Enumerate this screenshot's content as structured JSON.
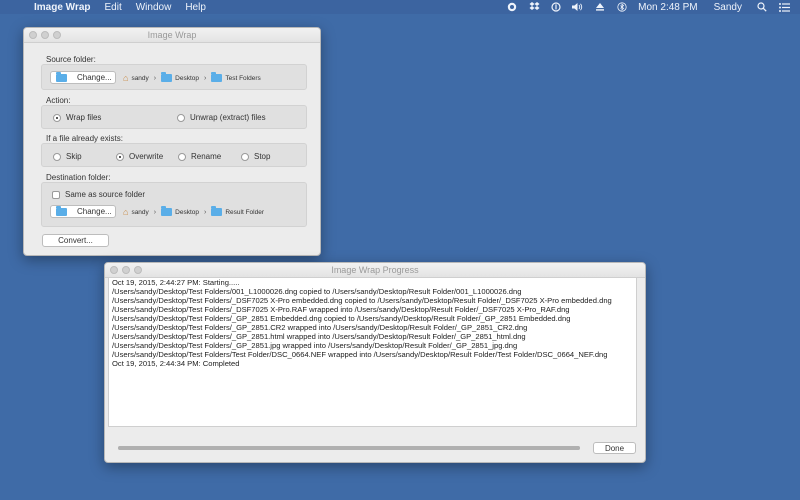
{
  "menubar": {
    "apple_glyph": "",
    "app_name": "Image Wrap",
    "menus": [
      "Edit",
      "Window",
      "Help"
    ],
    "clock": "Mon 2:48 PM",
    "user": "Sandy"
  },
  "main_window": {
    "title": "Image Wrap",
    "source": {
      "label": "Source folder:",
      "change_label": "Change...",
      "path": [
        "sandy",
        "Desktop",
        "Test Folders"
      ]
    },
    "action": {
      "label": "Action:",
      "options": [
        "Wrap files",
        "Unwrap (extract) files"
      ],
      "selected": "Wrap files"
    },
    "exists": {
      "label": "If a file already exists:",
      "options": [
        "Skip",
        "Overwrite",
        "Rename",
        "Stop"
      ],
      "selected": "Overwrite"
    },
    "destination": {
      "label": "Destination folder:",
      "same_as_source_label": "Same as source folder",
      "same_as_source_checked": false,
      "change_label": "Change...",
      "path": [
        "sandy",
        "Desktop",
        "Result Folder"
      ]
    },
    "convert_label": "Convert..."
  },
  "progress_window": {
    "title": "Image Wrap Progress",
    "log": [
      "Oct 19, 2015, 2:44:27 PM: Starting.....",
      "/Users/sandy/Desktop/Test Folders/001_L1000026.dng copied to /Users/sandy/Desktop/Result Folder/001_L1000026.dng",
      "/Users/sandy/Desktop/Test Folders/_DSF7025 X-Pro embedded.dng copied to /Users/sandy/Desktop/Result Folder/_DSF7025 X-Pro embedded.dng",
      "/Users/sandy/Desktop/Test Folders/_DSF7025 X-Pro.RAF wrapped into /Users/sandy/Desktop/Result Folder/_DSF7025 X-Pro_RAF.dng",
      "/Users/sandy/Desktop/Test Folders/_GP_2851 Embedded.dng copied to /Users/sandy/Desktop/Result Folder/_GP_2851 Embedded.dng",
      "/Users/sandy/Desktop/Test Folders/_GP_2851.CR2 wrapped into /Users/sandy/Desktop/Result Folder/_GP_2851_CR2.dng",
      "/Users/sandy/Desktop/Test Folders/_GP_2851.html wrapped into /Users/sandy/Desktop/Result Folder/_GP_2851_html.dng",
      "/Users/sandy/Desktop/Test Folders/_GP_2851.jpg wrapped into /Users/sandy/Desktop/Result Folder/_GP_2851_jpg.dng",
      "/Users/sandy/Desktop/Test Folders/Test Folder/DSC_0664.NEF wrapped into /Users/sandy/Desktop/Result Folder/Test Folder/DSC_0664_NEF.dng",
      "Oct 19, 2015, 2:44:34 PM: Completed"
    ],
    "progress": 1.0,
    "done_label": "Done"
  }
}
